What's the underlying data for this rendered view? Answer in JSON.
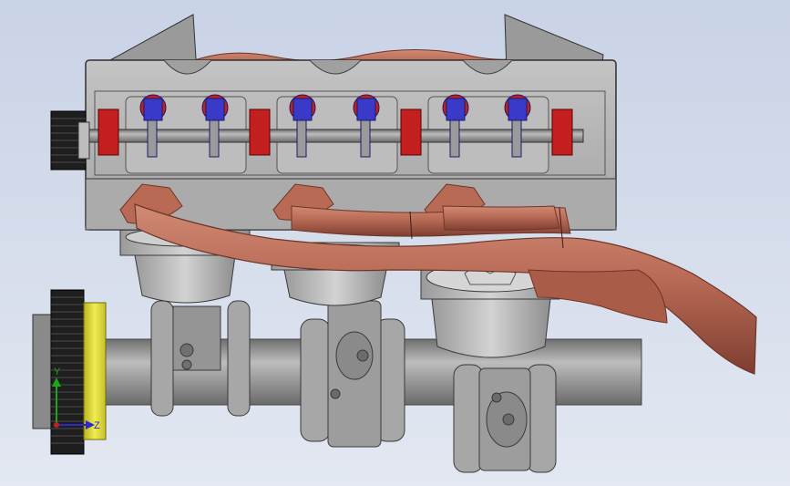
{
  "viewport": {
    "background_top": "#c9d3e6",
    "background_bottom": "#e3e8f2"
  },
  "model": {
    "part_colors": {
      "block": "#a9a9a9",
      "head": "#b7b7b7",
      "exhaust_pipe": "#b86a55",
      "exhaust_shadow": "#8e4a3a",
      "bolt_red": "#c41f1f",
      "valve_blue": "#3a3ac8",
      "pulley_dark": "#1c1c1c",
      "pulley_yellow": "#e9e23a",
      "crankshaft": "#8c8c8c"
    },
    "cylinders": 3,
    "valve_pairs": 3,
    "head_bolts": 4
  },
  "triad": {
    "y_label": "Y",
    "z_label": "Z",
    "y_color": "#1aa81a",
    "z_color": "#2a2ac8"
  }
}
